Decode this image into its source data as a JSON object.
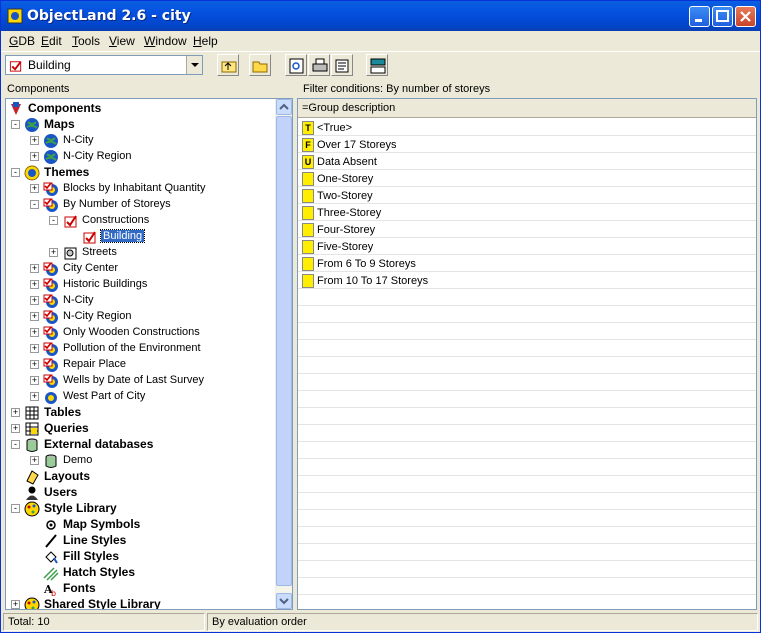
{
  "window": {
    "title": "ObjectLand 2.6  - city"
  },
  "menu": [
    {
      "label": "GDB",
      "key": "G"
    },
    {
      "label": "Edit",
      "key": "E"
    },
    {
      "label": "Tools",
      "key": "T"
    },
    {
      "label": "View",
      "key": "V"
    },
    {
      "label": "Window",
      "key": "W"
    },
    {
      "label": "Help",
      "key": "H"
    }
  ],
  "toolbar": {
    "combo_value": "Building"
  },
  "left_header": "Components",
  "right_header": "Filter conditions: By number of storeys",
  "column_header": "=Group description",
  "tree": [
    {
      "label": "Components",
      "bold": true,
      "icon": "components-icon"
    },
    {
      "label": "Maps",
      "bold": true,
      "icon": "globe-icon"
    },
    {
      "label": "N-City",
      "icon": "globe-icon"
    },
    {
      "label": "N-City Region",
      "icon": "globe-icon"
    },
    {
      "label": "Themes",
      "bold": true,
      "icon": "themes-icon"
    },
    {
      "label": "Blocks by Inhabitant Quantity",
      "icon": "theme-check-icon"
    },
    {
      "label": "By Number of Storeys",
      "icon": "theme-check-icon"
    },
    {
      "label": "Constructions",
      "icon": "layer-check-icon"
    },
    {
      "label": "Building",
      "icon": "layer-check-icon",
      "selected": true
    },
    {
      "label": "Streets",
      "icon": "layer-icon"
    },
    {
      "label": "City Center",
      "icon": "theme-check-icon"
    },
    {
      "label": "Historic Buildings",
      "icon": "theme-check-icon"
    },
    {
      "label": "N-City",
      "icon": "theme-check-icon"
    },
    {
      "label": "N-City Region",
      "icon": "theme-check-icon"
    },
    {
      "label": "Only Wooden Constructions",
      "icon": "theme-check-icon"
    },
    {
      "label": "Pollution of the Environment",
      "icon": "theme-check-icon"
    },
    {
      "label": "Repair Place",
      "icon": "theme-check-icon"
    },
    {
      "label": "Wells by Date of Last Survey",
      "icon": "theme-check-icon"
    },
    {
      "label": "West Part of City",
      "icon": "theme-icon"
    },
    {
      "label": "Tables",
      "bold": true,
      "icon": "table-icon"
    },
    {
      "label": "Queries",
      "bold": true,
      "icon": "query-icon"
    },
    {
      "label": "External databases",
      "bold": true,
      "icon": "database-icon"
    },
    {
      "label": "Demo",
      "icon": "database-icon"
    },
    {
      "label": "Layouts",
      "bold": true,
      "icon": "layout-icon"
    },
    {
      "label": "Users",
      "bold": true,
      "icon": "user-icon"
    },
    {
      "label": "Style Library",
      "bold": true,
      "icon": "style-icon"
    },
    {
      "label": "Map Symbols",
      "bold": true,
      "icon": "symbol-icon"
    },
    {
      "label": "Line Styles",
      "bold": true,
      "icon": "line-style-icon"
    },
    {
      "label": "Fill Styles",
      "bold": true,
      "icon": "fill-style-icon"
    },
    {
      "label": "Hatch Styles",
      "bold": true,
      "icon": "hatch-style-icon"
    },
    {
      "label": "Fonts",
      "bold": true,
      "icon": "font-icon"
    },
    {
      "label": "Shared Style Library",
      "bold": true,
      "icon": "style-icon"
    }
  ],
  "groups": [
    {
      "badge": "T",
      "label": "<True>"
    },
    {
      "badge": "F",
      "label": "Over 17 Storeys"
    },
    {
      "badge": "U",
      "label": "Data Absent"
    },
    {
      "badge": "",
      "label": "One-Storey"
    },
    {
      "badge": "",
      "label": "Two-Storey"
    },
    {
      "badge": "",
      "label": "Three-Storey"
    },
    {
      "badge": "",
      "label": "Four-Storey"
    },
    {
      "badge": "",
      "label": "Five-Storey"
    },
    {
      "badge": "",
      "label": "From 6 To 9 Storeys"
    },
    {
      "badge": "",
      "label": "From 10 To 17 Storeys"
    }
  ],
  "status": {
    "total": "Total: 10",
    "order": "By evaluation order"
  }
}
